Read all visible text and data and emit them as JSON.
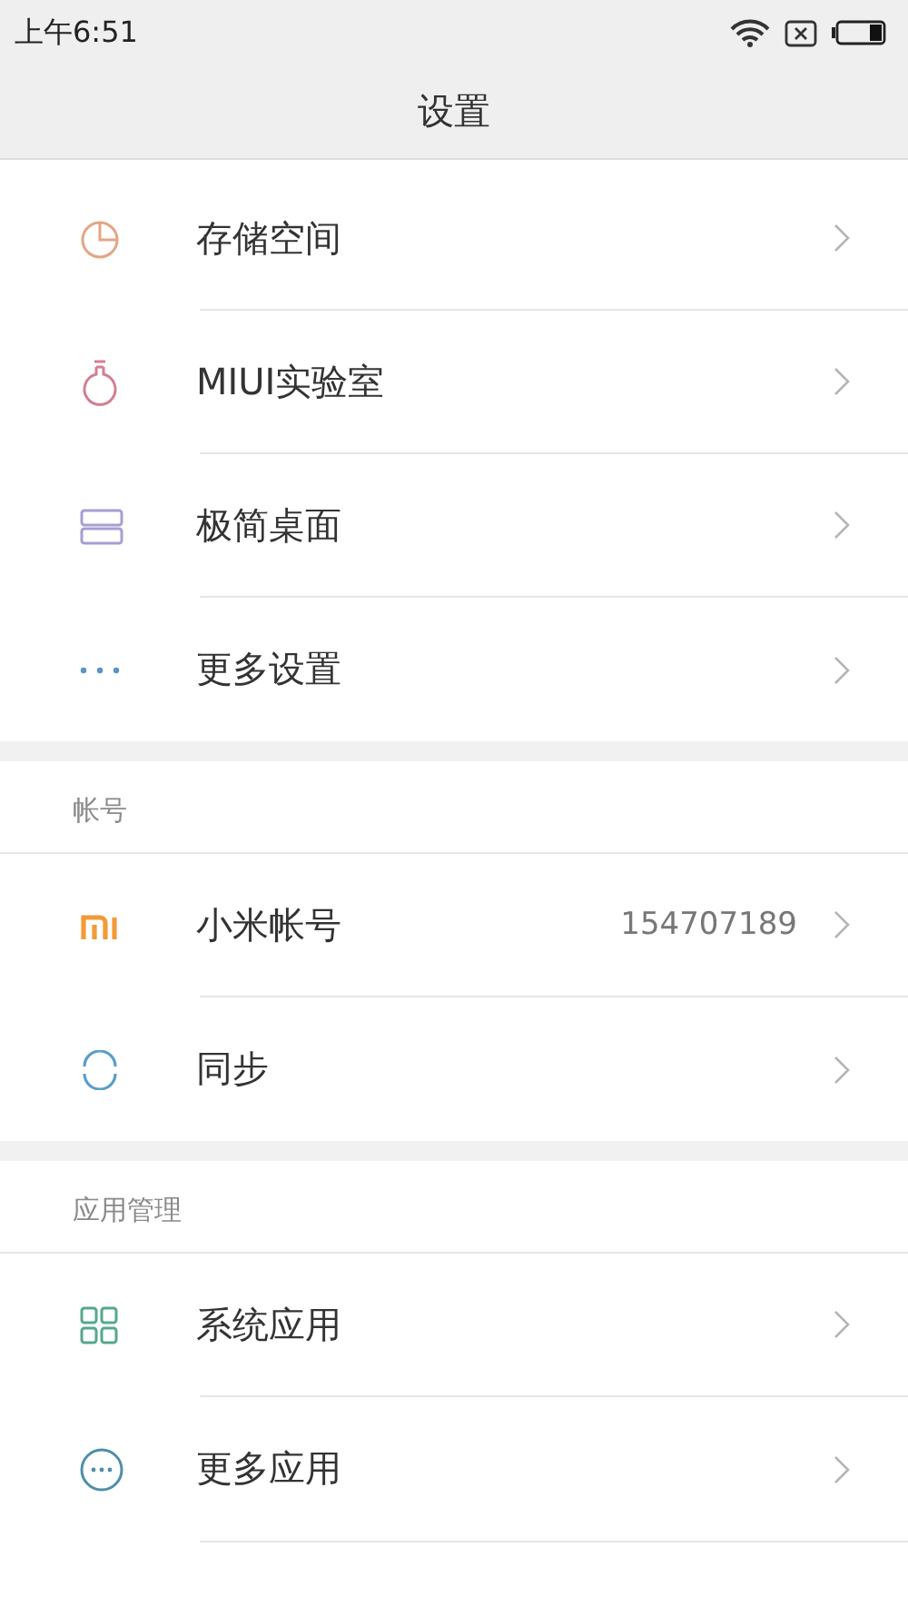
{
  "status_bar": {
    "time": "上午6:51"
  },
  "title": "设置",
  "sections": [
    {
      "items": [
        {
          "label": "存储空间"
        },
        {
          "label": "MIUI实验室"
        },
        {
          "label": "极简桌面"
        },
        {
          "label": "更多设置"
        }
      ]
    },
    {
      "header": "帐号",
      "items": [
        {
          "label": "小米帐号",
          "value": "154707189"
        },
        {
          "label": "同步"
        }
      ]
    },
    {
      "header": "应用管理",
      "items": [
        {
          "label": "系统应用"
        },
        {
          "label": "更多应用"
        }
      ]
    }
  ]
}
